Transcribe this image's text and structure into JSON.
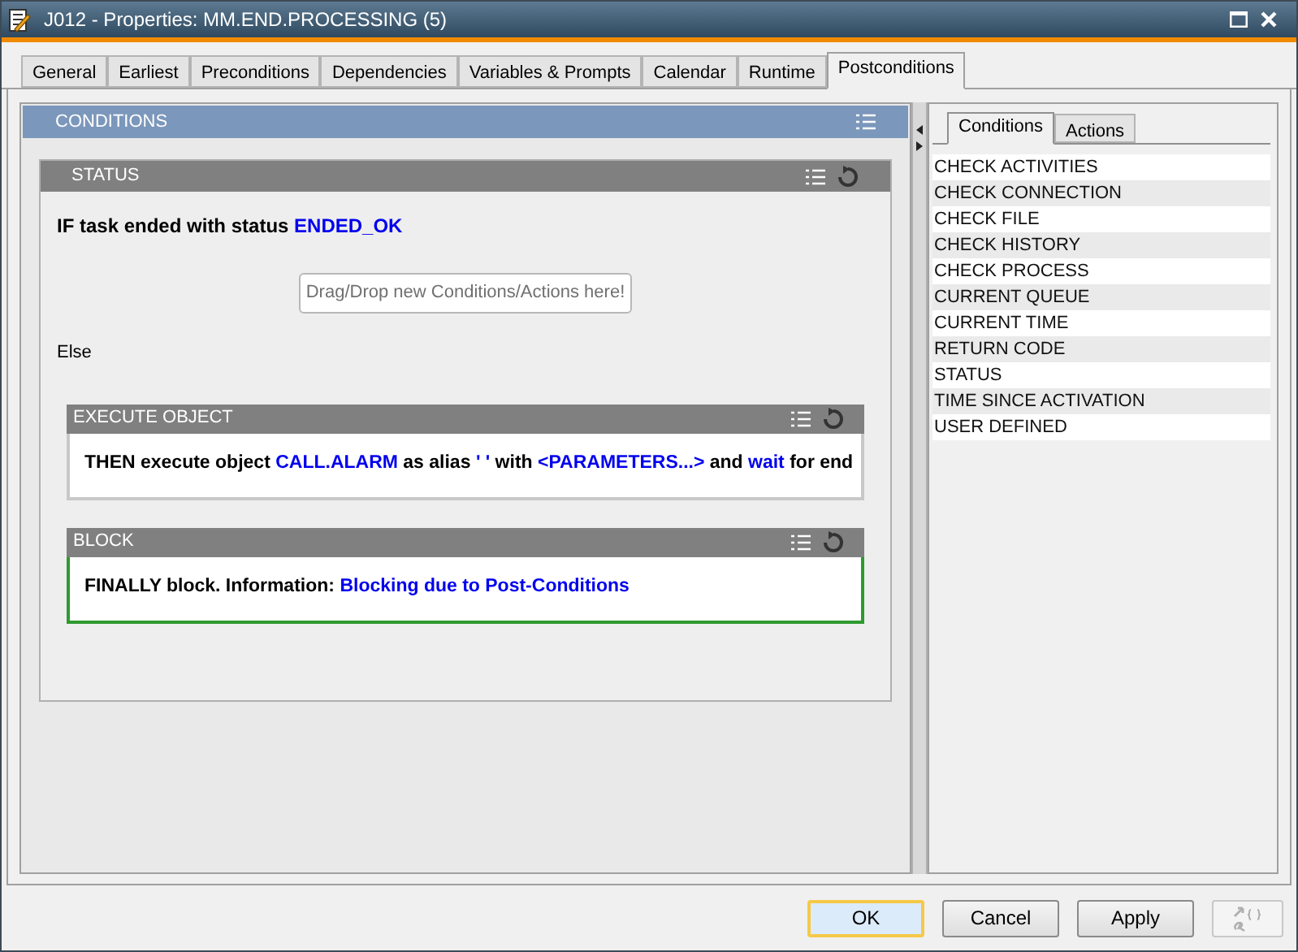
{
  "window": {
    "title": "J012 - Properties: MM.END.PROCESSING (5)"
  },
  "tabs": [
    {
      "label": "General",
      "selected": false
    },
    {
      "label": "Earliest",
      "selected": false
    },
    {
      "label": "Preconditions",
      "selected": false
    },
    {
      "label": "Dependencies",
      "selected": false
    },
    {
      "label": "Variables & Prompts",
      "selected": false
    },
    {
      "label": "Calendar",
      "selected": false
    },
    {
      "label": "Runtime",
      "selected": false
    },
    {
      "label": "Postconditions",
      "selected": true
    }
  ],
  "conditions_panel": {
    "title": "CONDITIONS",
    "status_block": {
      "title": "STATUS",
      "sentence": [
        {
          "kind": "text",
          "text": "IF task ended with status "
        },
        {
          "kind": "value",
          "text": "ENDED_OK"
        }
      ],
      "drop_hint": "Drag/Drop new Conditions/Actions here!",
      "else_label": "Else"
    },
    "actions": [
      {
        "title": "EXECUTE OBJECT",
        "selected": false,
        "sentence": [
          {
            "kind": "text",
            "text": "THEN execute object "
          },
          {
            "kind": "value",
            "text": "CALL.ALARM"
          },
          {
            "kind": "text",
            "text": " as alias "
          },
          {
            "kind": "value",
            "text": "' '"
          },
          {
            "kind": "text",
            "text": " with "
          },
          {
            "kind": "value",
            "text": "<PARAMETERS...>"
          },
          {
            "kind": "text",
            "text": " and "
          },
          {
            "kind": "value",
            "text": "wait"
          },
          {
            "kind": "text",
            "text": " for end"
          }
        ]
      },
      {
        "title": "BLOCK",
        "selected": true,
        "sentence": [
          {
            "kind": "text",
            "text": "FINALLY block. Information: "
          },
          {
            "kind": "value",
            "text": "Blocking due to Post-Conditions"
          }
        ]
      }
    ]
  },
  "palette": {
    "tabs": [
      {
        "label": "Conditions",
        "selected": true
      },
      {
        "label": "Actions",
        "selected": false
      }
    ],
    "items": [
      "CHECK ACTIVITIES",
      "CHECK CONNECTION",
      "CHECK FILE",
      "CHECK HISTORY",
      "CHECK PROCESS",
      "CURRENT QUEUE",
      "CURRENT TIME",
      "RETURN CODE",
      "STATUS",
      "TIME SINCE ACTIVATION",
      "USER DEFINED"
    ]
  },
  "buttons": [
    {
      "label": "OK",
      "default": true
    },
    {
      "label": "Cancel",
      "default": false
    },
    {
      "label": "Apply",
      "default": false
    }
  ],
  "variable_button": {
    "disabled": true
  }
}
